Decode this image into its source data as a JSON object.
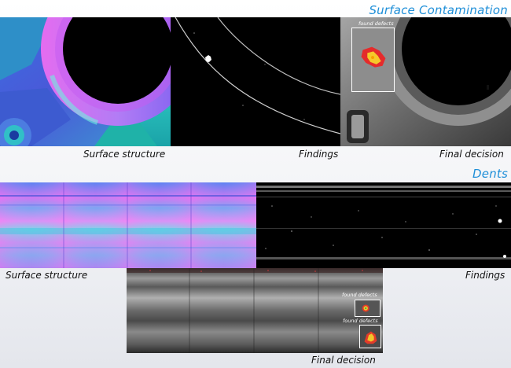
{
  "sections": {
    "surface_contamination": {
      "title": "Surface Contamination",
      "captions": {
        "structure": "Surface structure",
        "findings": "Findings",
        "decision": "Final decision"
      },
      "overlay_label": "found defects"
    },
    "dents": {
      "title": "Dents",
      "captions": {
        "structure": "Surface structure",
        "findings": "Findings",
        "decision": "Final decision"
      },
      "overlay_labels": [
        "found defects",
        "found defects"
      ]
    }
  },
  "colors": {
    "title": "#1f8fd8",
    "defect_box": "#ffffff",
    "structure_magenta": "#e06ef0",
    "structure_teal": "#2fc6c4",
    "structure_blue": "#3b5fe0"
  }
}
